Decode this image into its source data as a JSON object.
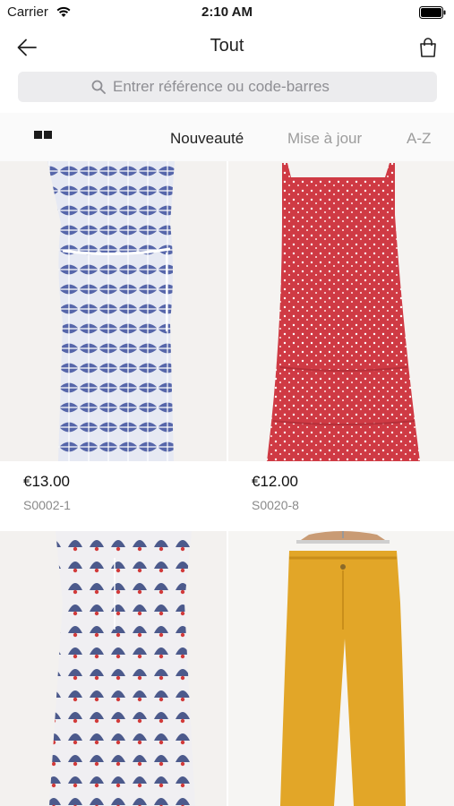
{
  "status_bar": {
    "carrier": "Carrier",
    "time": "2:10 AM"
  },
  "nav": {
    "title": "Tout",
    "back_icon": "arrow-left-icon",
    "bag_icon": "shopping-bag-icon"
  },
  "search": {
    "placeholder": "Entrer référence ou code-barres",
    "value": ""
  },
  "sort": {
    "options": [
      "Nouveauté",
      "Mise à jour",
      "A-Z"
    ],
    "selected": "Nouveauté"
  },
  "products": [
    {
      "price": "€13.00",
      "sku": "S0002-1",
      "color": "#3d4f9e"
    },
    {
      "price": "€12.00",
      "sku": "S0020-8",
      "color": "#cf3a44"
    },
    {
      "price": "",
      "sku": "",
      "color": "#2f3f7a"
    },
    {
      "price": "",
      "sku": "",
      "color": "#e2a628"
    }
  ],
  "colors": {
    "search_bg": "#ececee",
    "muted_text": "#9c9c9c"
  }
}
